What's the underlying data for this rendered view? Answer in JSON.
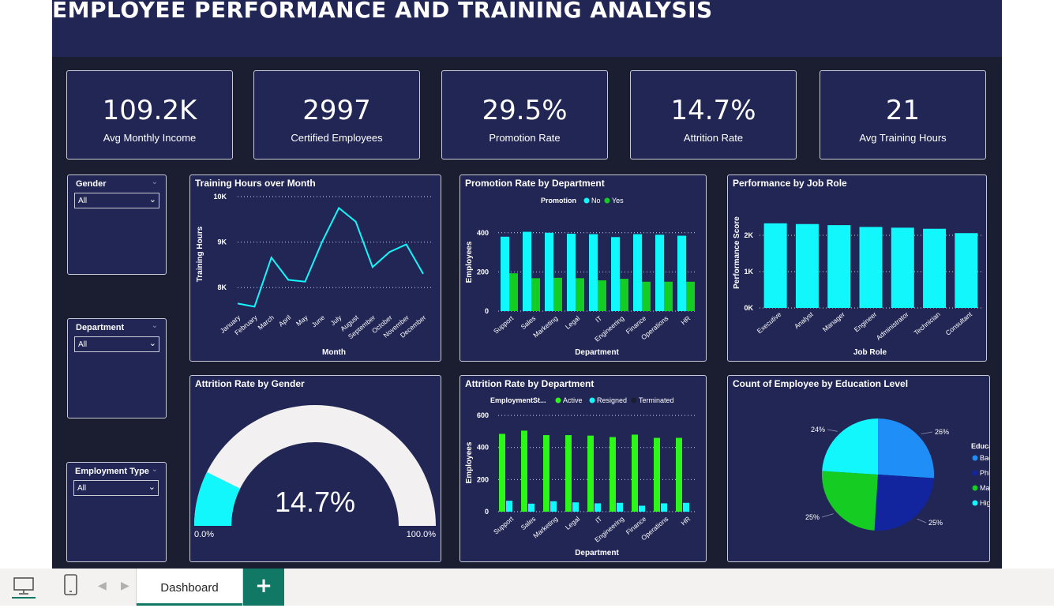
{
  "title": "EMPLOYEE PERFORMANCE AND TRAINING ANALYSIS",
  "kpis": [
    {
      "value": "109.2K",
      "label": "Avg Monthly Income"
    },
    {
      "value": "2997",
      "label": "Certified Employees"
    },
    {
      "value": "29.5%",
      "label": "Promotion Rate"
    },
    {
      "value": "14.7%",
      "label": "Attrition Rate"
    },
    {
      "value": "21",
      "label": "Avg Training Hours"
    }
  ],
  "slicers": [
    {
      "title": "Gender",
      "value": "All"
    },
    {
      "title": "Department",
      "value": "All"
    },
    {
      "title": "Employment Type",
      "value": "All"
    }
  ],
  "taskbar": {
    "tab_label": "Dashboard",
    "add_label": "+"
  },
  "colors": {
    "cyan": "#12f7fb",
    "green": "#15cc22",
    "bright_green": "#2ef51a",
    "blue": "#1f8ff7",
    "navy": "#12249e",
    "panel": "#222654",
    "background": "#1b1e30"
  },
  "chart_data": [
    {
      "type": "line",
      "title": "Training Hours over Month",
      "xlabel": "Month",
      "ylabel": "Training Hours",
      "categories": [
        "January",
        "February",
        "March",
        "April",
        "May",
        "June",
        "July",
        "August",
        "September",
        "October",
        "November",
        "December"
      ],
      "values": [
        7650,
        7580,
        8660,
        8170,
        8130,
        9000,
        9750,
        9450,
        8450,
        8780,
        8950,
        8300
      ],
      "yticks": [
        "8K",
        "9K",
        "10K"
      ],
      "ylim": [
        7500,
        10000
      ],
      "grid": true
    },
    {
      "type": "bar",
      "title": "Promotion Rate by Department",
      "legend_title": "Promotion",
      "xlabel": "Department",
      "ylabel": "Employees",
      "categories": [
        "Support",
        "Sales",
        "Marketing",
        "Legal",
        "IT",
        "Engineering",
        "Finance",
        "Operations",
        "HR"
      ],
      "series": [
        {
          "name": "No",
          "values": [
            380,
            405,
            400,
            395,
            393,
            378,
            393,
            390,
            385
          ]
        },
        {
          "name": "Yes",
          "values": [
            193,
            168,
            170,
            168,
            157,
            165,
            150,
            150,
            150
          ]
        }
      ],
      "yticks": [
        "0",
        "200",
        "400"
      ],
      "ylim": [
        0,
        500
      ],
      "grid": true
    },
    {
      "type": "bar",
      "title": "Performance by Job Role",
      "xlabel": "Job Role",
      "ylabel": "Performance Score",
      "categories": [
        "Executive",
        "Analyst",
        "Manager",
        "Engineer",
        "Administrator",
        "Technician",
        "Consultant"
      ],
      "values": [
        2330,
        2310,
        2280,
        2230,
        2210,
        2180,
        2060
      ],
      "yticks": [
        "0K",
        "1K",
        "2K"
      ],
      "ylim": [
        0,
        2500
      ],
      "grid": true
    },
    {
      "type": "gauge",
      "title": "Attrition Rate by Gender",
      "value": 14.7,
      "value_label": "14.7%",
      "min_label": "0.0%",
      "max_label": "100.0%"
    },
    {
      "type": "bar",
      "title": "Attrition Rate by Department",
      "legend_title": "EmploymentSt...",
      "xlabel": "Department",
      "ylabel": "Employees",
      "categories": [
        "Support",
        "Sales",
        "Marketing",
        "Legal",
        "IT",
        "Engineering",
        "Finance",
        "Operations",
        "HR"
      ],
      "series": [
        {
          "name": "Active",
          "values": [
            485,
            505,
            477,
            477,
            474,
            465,
            480,
            460,
            460
          ]
        },
        {
          "name": "Resigned",
          "values": [
            68,
            50,
            65,
            58,
            52,
            55,
            37,
            52,
            55
          ]
        },
        {
          "name": "Terminated",
          "values": [
            0,
            0,
            0,
            0,
            0,
            0,
            0,
            0,
            0
          ]
        }
      ],
      "yticks": [
        "0",
        "200",
        "400",
        "600"
      ],
      "ylim": [
        0,
        620
      ],
      "grid": true
    },
    {
      "type": "pie",
      "title": "Count of Employee by Education Level",
      "legend_title": "Education Level",
      "labels": [
        "Bachelor",
        "PhD",
        "Master",
        "High School"
      ],
      "values": [
        26,
        25,
        25,
        24
      ],
      "value_labels": [
        "26%",
        "25%",
        "25%",
        "24%"
      ],
      "legend": "right"
    }
  ]
}
